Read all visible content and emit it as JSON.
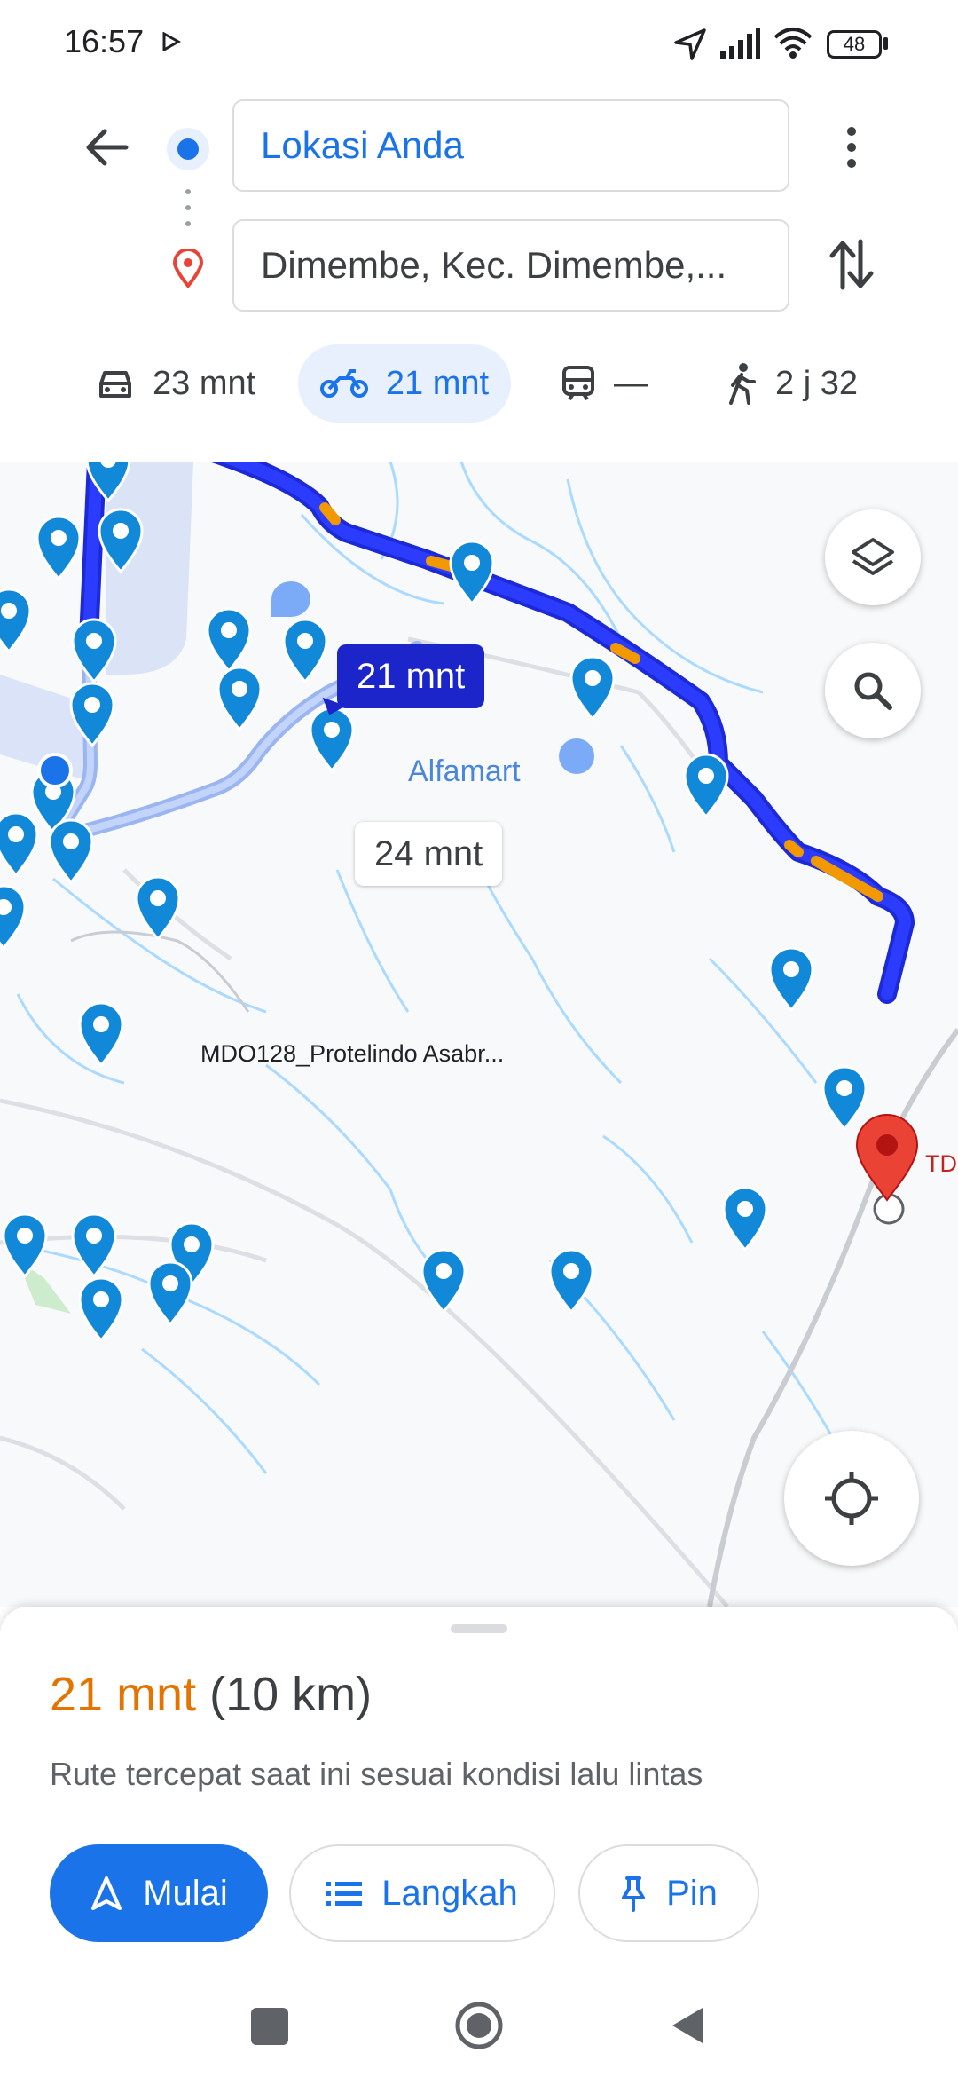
{
  "status_bar": {
    "time": "16:57",
    "battery": "48"
  },
  "directions": {
    "origin": "Lokasi Anda",
    "destination": "Dimembe, Kec. Dimembe,..."
  },
  "modes": [
    {
      "name": "car",
      "label": "23 mnt"
    },
    {
      "name": "motorcycle",
      "label": "21 mnt",
      "selected": true
    },
    {
      "name": "transit",
      "label": "—"
    },
    {
      "name": "walk",
      "label": "2 j 32"
    }
  ],
  "map": {
    "route_eta": "21 mnt",
    "alt_route_eta": "24 mnt",
    "poi_alfamart": "Alfamart",
    "poi_tower": "MDO128_Protelindo Asabr...",
    "dest_marker_label": "TD"
  },
  "sheet": {
    "duration": "21 mnt",
    "distance": "(10 km)",
    "description": "Rute tercepat saat ini sesuai kondisi lalu lintas",
    "start_label": "Mulai",
    "steps_label": "Langkah",
    "pin_label": "Pin"
  },
  "colors": {
    "accent": "#1a73e8",
    "route": "#1a2cf0",
    "traffic": "#f29900",
    "duration": "#e37400",
    "pin": "#1288d8",
    "destination_marker": "#ea4335"
  }
}
